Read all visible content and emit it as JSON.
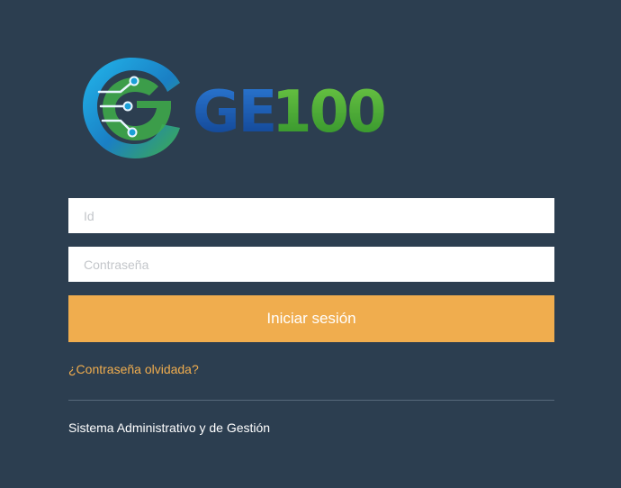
{
  "logo": {
    "text_prefix": "GE",
    "text_suffix": "100",
    "colors": {
      "blue": "#1f5fb0",
      "green": "#4caf3a",
      "swirl_blue": "#1aa0d8",
      "swirl_green": "#3fae49"
    }
  },
  "form": {
    "id_placeholder": "Id",
    "password_placeholder": "Contraseña",
    "login_button_label": "Iniciar sesión",
    "forgot_password_link": "¿Contraseña olvidada?"
  },
  "footer": {
    "system_name": "Sistema Administrativo y de Gestión"
  },
  "colors": {
    "background": "#2c3e50",
    "accent": "#f0ad4e",
    "input_background": "#ffffff"
  }
}
